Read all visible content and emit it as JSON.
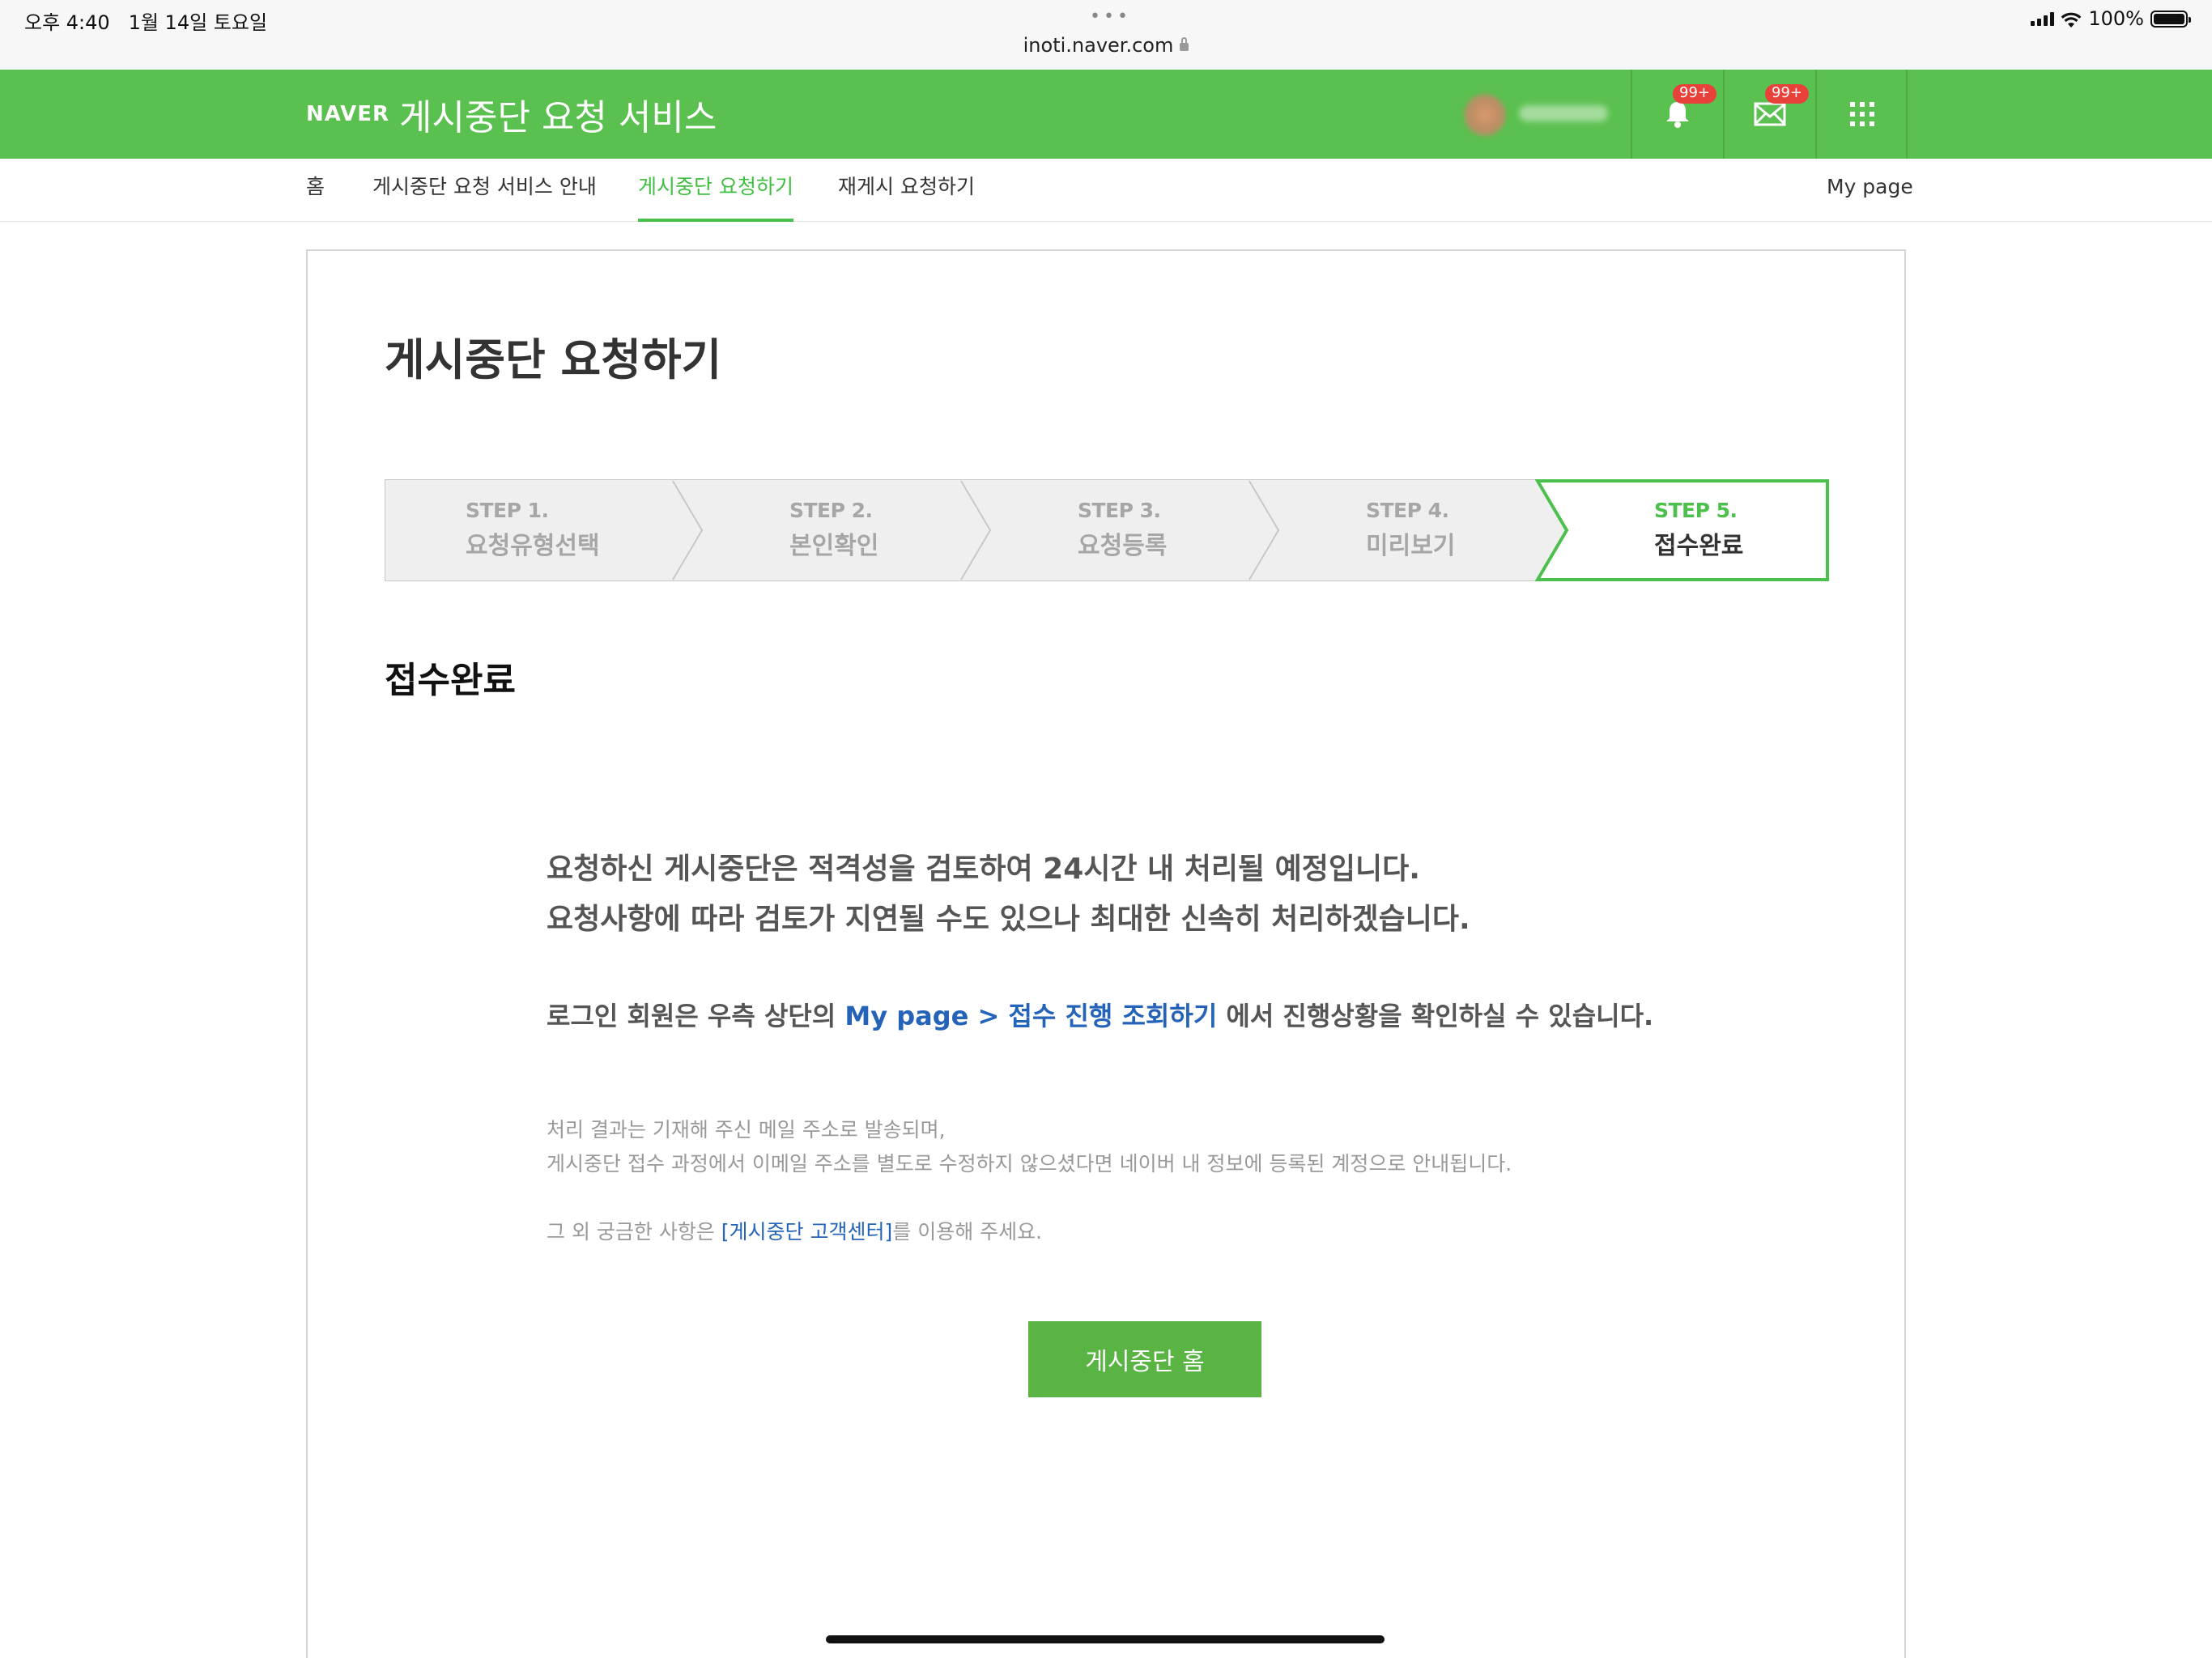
{
  "status_bar": {
    "time": "오후 4:40",
    "date": "1월 14일 토요일",
    "dots": "•••",
    "url": "inoti.naver.com",
    "battery": "100%",
    "battery_level": 1.0
  },
  "header": {
    "brand": "NAVER",
    "title": "게시중단 요청 서비스",
    "notifications_badge": "99+",
    "mail_badge": "99+",
    "accent_color": "#5ac04f"
  },
  "nav": {
    "items": [
      {
        "label": "홈"
      },
      {
        "label": "게시중단 요청 서비스 안내"
      },
      {
        "label": "게시중단 요청하기"
      },
      {
        "label": "재게시 요청하기"
      }
    ],
    "mypage": "My page",
    "active_color": "#3fbf3f"
  },
  "page": {
    "title": "게시중단 요청하기",
    "steps": [
      {
        "num": "STEP 1.",
        "name": "요청유형선택"
      },
      {
        "num": "STEP 2.",
        "name": "본인확인"
      },
      {
        "num": "STEP 3.",
        "name": "요청등록"
      },
      {
        "num": "STEP 4.",
        "name": "미리보기"
      },
      {
        "num": "STEP 5.",
        "name": "접수완료"
      }
    ],
    "current_step": 5,
    "section_title": "접수완료",
    "message_line1": "요청하신 게시중단은 적격성을 검토하여 24시간 내 처리될 예정입니다.",
    "message_line2": "요청사항에 따라 검토가 지연될 수도 있으나 최대한 신속히 처리하겠습니다.",
    "info_prefix": "로그인 회원은 우측 상단의 ",
    "info_link": "My page > 접수 진행 조회하기",
    "info_suffix": " 에서 진행상황을 확인하실 수 있습니다.",
    "note_line1": "처리 결과는 기재해 주신 메일 주소로 발송되며,",
    "note_line2": "게시중단 접수 과정에서 이메일 주소를 별도로 수정하지 않으셨다면 네이버 내 정보에 등록된 계정으로 안내됩니다.",
    "note3_prefix": "그 외 궁금한 사항은 ",
    "note3_link": "[게시중단 고객센터]",
    "note3_suffix": "를 이용해 주세요.",
    "home_button": "게시중단 홈",
    "link_color": "#2463b8",
    "button_color": "#5ab444"
  }
}
